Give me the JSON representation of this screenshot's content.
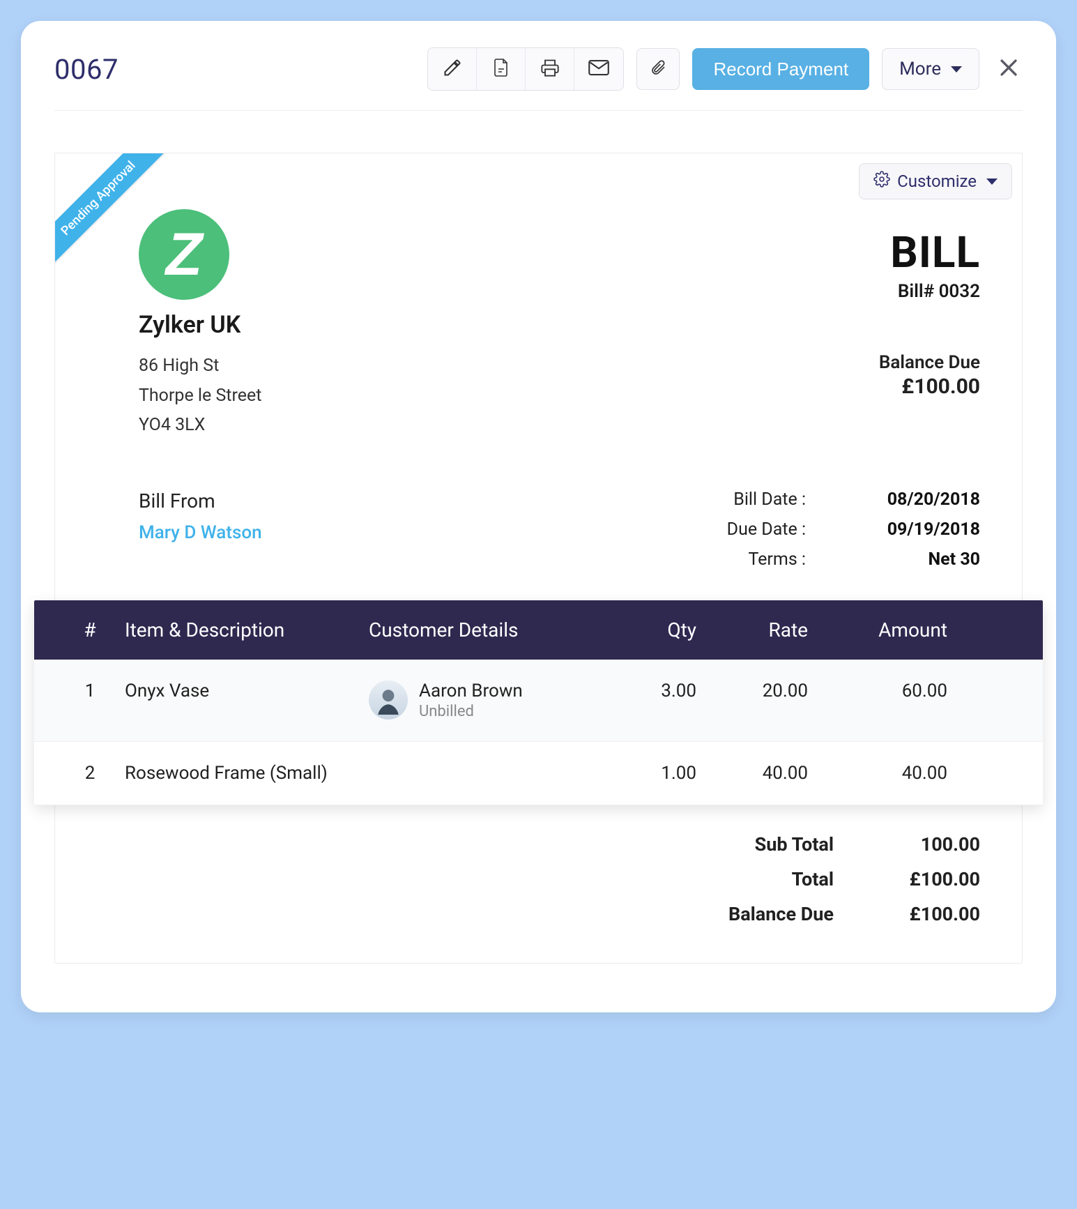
{
  "header": {
    "doc_id": "0067",
    "record_payment_label": "Record Payment",
    "more_label": "More"
  },
  "ribbon": {
    "status": "Pending Approval"
  },
  "customize_label": "Customize",
  "company": {
    "name": "Zylker UK",
    "address_lines": [
      "86 High St",
      "Thorpe le Street",
      "YO4 3LX"
    ]
  },
  "bill": {
    "title": "BILL",
    "number_label": "Bill# 0032",
    "balance_label": "Balance Due",
    "balance_amount": "£100.00"
  },
  "bill_from": {
    "label": "Bill From",
    "name": "Mary D Watson"
  },
  "meta": {
    "bill_date_label": "Bill Date :",
    "bill_date": "08/20/2018",
    "due_date_label": "Due Date :",
    "due_date": "09/19/2018",
    "terms_label": "Terms :",
    "terms": "Net 30"
  },
  "columns": {
    "num": "#",
    "item": "Item & Description",
    "customer": "Customer Details",
    "qty": "Qty",
    "rate": "Rate",
    "amount": "Amount"
  },
  "items": [
    {
      "num": "1",
      "name": "Onyx Vase",
      "customer": {
        "name": "Aaron Brown",
        "status": "Unbilled",
        "has_avatar": true
      },
      "qty": "3.00",
      "rate": "20.00",
      "amount": "60.00"
    },
    {
      "num": "2",
      "name": "Rosewood Frame (Small)",
      "customer": null,
      "qty": "1.00",
      "rate": "40.00",
      "amount": "40.00"
    }
  ],
  "totals": {
    "subtotal_label": "Sub Total",
    "subtotal": "100.00",
    "total_label": "Total",
    "total": "£100.00",
    "balance_label": "Balance Due",
    "balance": "£100.00"
  }
}
